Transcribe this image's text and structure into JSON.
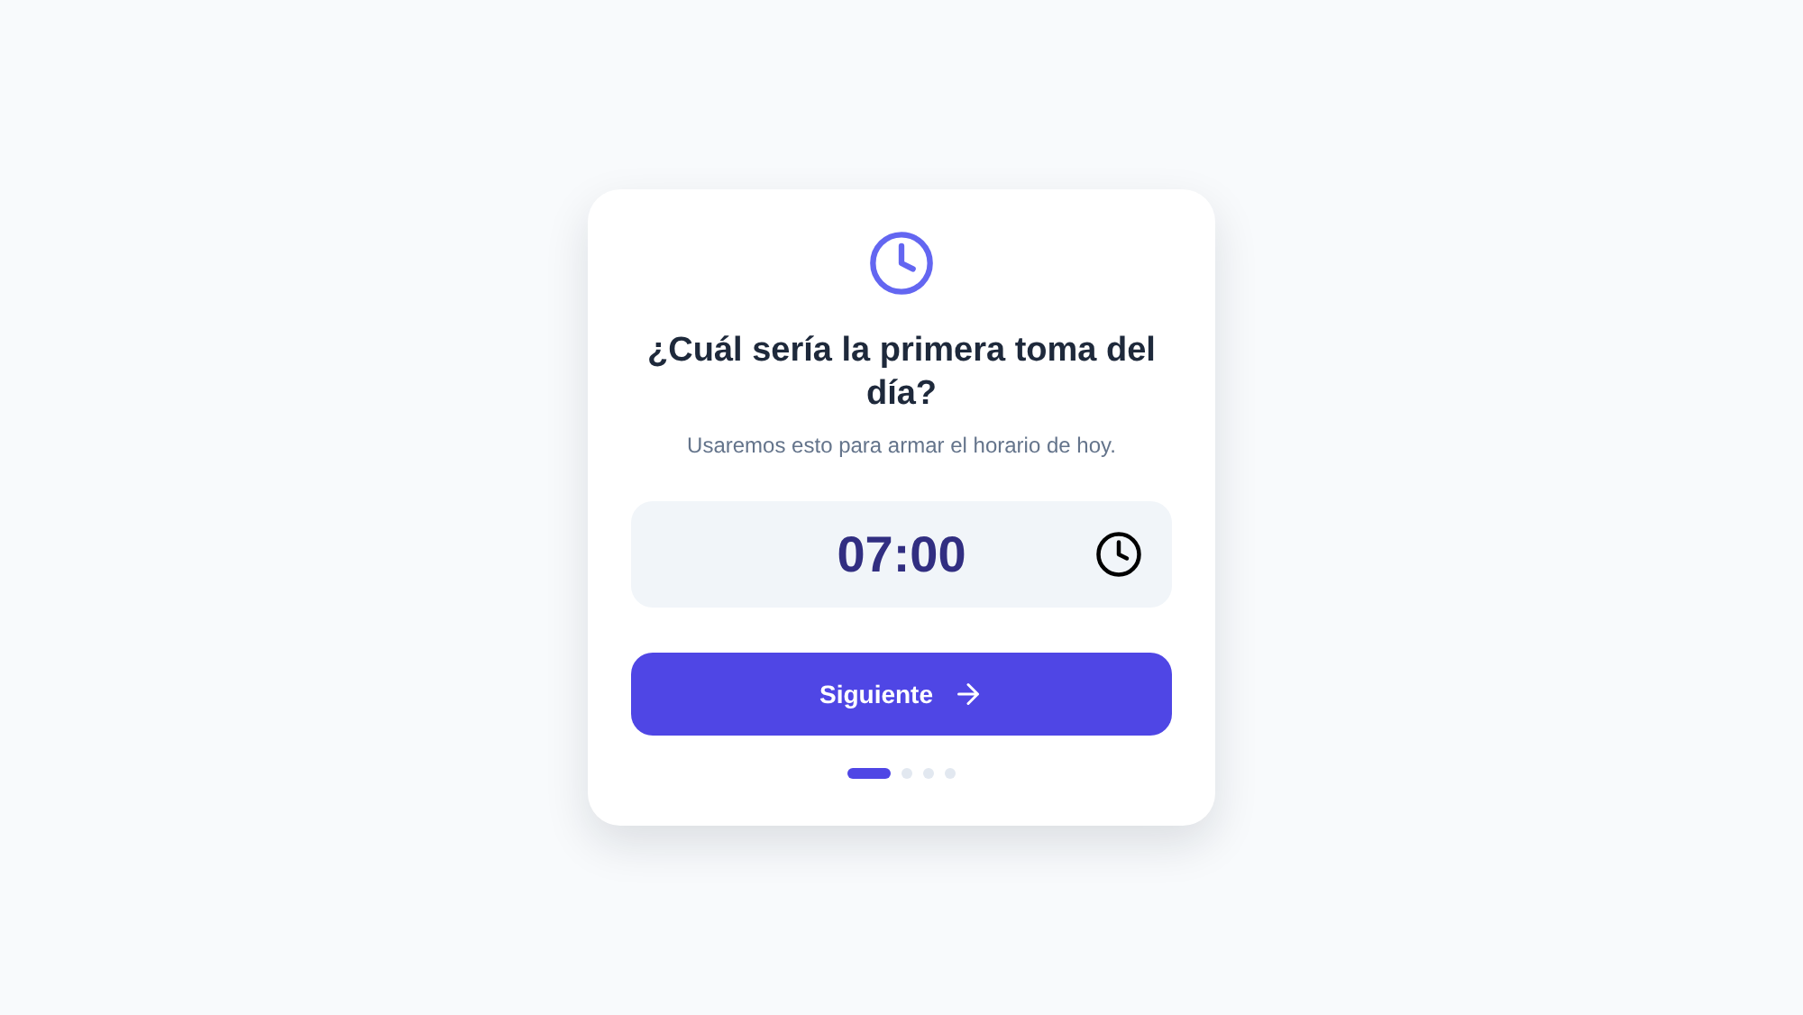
{
  "card": {
    "title": "¿Cuál sería la primera toma del día?",
    "subtitle": "Usaremos esto para armar el horario de hoy.",
    "time_field": {
      "value": "07:00"
    },
    "next_button": {
      "label": "Siguiente"
    },
    "steps": [
      {
        "selected": true
      },
      {
        "selected": false
      },
      {
        "selected": false
      },
      {
        "selected": false
      }
    ]
  }
}
